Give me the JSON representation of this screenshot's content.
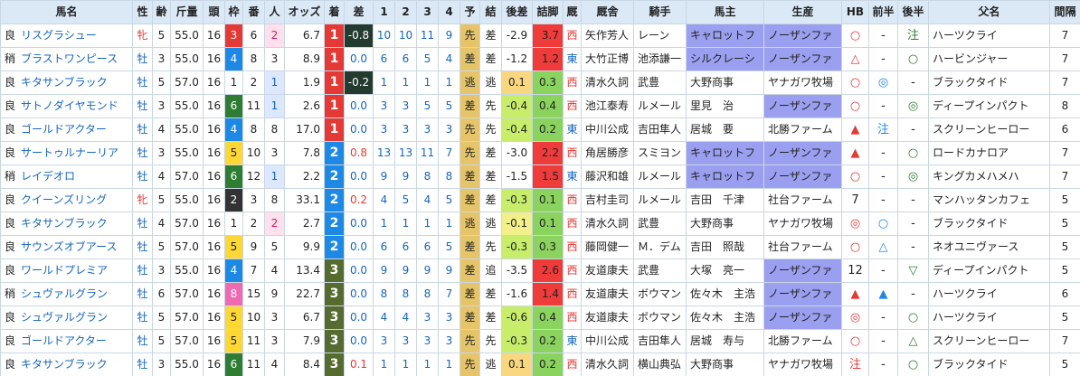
{
  "headers": [
    "馬名",
    "性",
    "齢",
    "斤量",
    "頭",
    "枠",
    "番",
    "人",
    "オッズ",
    "着",
    "差",
    "1",
    "2",
    "3",
    "4",
    "予",
    "結",
    "後差",
    "詰脚",
    "厩",
    "厩舎",
    "騎手",
    "馬主",
    "生産",
    "HB",
    "前半",
    "後半",
    "父名",
    "間隔"
  ],
  "rows": [
    {
      "baba": "良",
      "name": "リスグラシュー",
      "sex": "牝",
      "age": "5",
      "weight": "55.0",
      "heads": "16",
      "waku": "3",
      "ban": "6",
      "ninki": "2",
      "odds": "6.7",
      "chaku": "1",
      "sa": "-0.8",
      "c1": "10",
      "c2": "10",
      "c3": "11",
      "c4": "9",
      "yo": "先",
      "ketsu": "差",
      "atosa": "-2.9",
      "tsume": "3.7",
      "kyu": "西",
      "trainer": "矢作芳人",
      "jockey": "レーン",
      "owner": "キャロットフ",
      "breeder": "ノーザンファ",
      "hb": "○",
      "zen": "-",
      "kou": "注",
      "sire": "ハーツクライ",
      "interval": "7"
    },
    {
      "baba": "稍",
      "name": "ブラストワンピース",
      "sex": "牡",
      "age": "3",
      "weight": "55.0",
      "heads": "16",
      "waku": "4",
      "ban": "8",
      "ninki": "3",
      "odds": "8.9",
      "chaku": "1",
      "sa": "0.0",
      "c1": "6",
      "c2": "6",
      "c3": "5",
      "c4": "4",
      "yo": "差",
      "ketsu": "差",
      "atosa": "-1.2",
      "tsume": "1.2",
      "kyu": "東",
      "trainer": "大竹正博",
      "jockey": "池添謙一",
      "owner": "シルクレーシ",
      "breeder": "ノーザンファ",
      "hb": "△",
      "zen": "-",
      "kou": "○",
      "sire": "ハービンジャー",
      "interval": "7"
    },
    {
      "baba": "良",
      "name": "キタサンブラック",
      "sex": "牡",
      "age": "5",
      "weight": "57.0",
      "heads": "16",
      "waku": "1",
      "ban": "2",
      "ninki": "1",
      "odds": "1.9",
      "chaku": "1",
      "sa": "-0.2",
      "c1": "1",
      "c2": "1",
      "c3": "1",
      "c4": "1",
      "yo": "逃",
      "ketsu": "逃",
      "atosa": "0.1",
      "tsume": "0.3",
      "kyu": "西",
      "trainer": "清水久詞",
      "jockey": "武豊",
      "owner": "大野商事",
      "breeder": "ヤナガワ牧場",
      "hb": "○",
      "zen": "◎",
      "kou": "-",
      "sire": "ブラックタイド",
      "interval": "7"
    },
    {
      "baba": "良",
      "name": "サトノダイヤモンド",
      "sex": "牡",
      "age": "3",
      "weight": "55.0",
      "heads": "16",
      "waku": "6",
      "ban": "11",
      "ninki": "1",
      "odds": "2.6",
      "chaku": "1",
      "sa": "0.0",
      "c1": "3",
      "c2": "3",
      "c3": "5",
      "c4": "5",
      "yo": "差",
      "ketsu": "先",
      "atosa": "-0.4",
      "tsume": "0.4",
      "kyu": "西",
      "trainer": "池江泰寿",
      "jockey": "ルメール",
      "owner": "里見　治",
      "breeder": "ノーザンファ",
      "hb": "○",
      "zen": "-",
      "kou": "◎",
      "sire": "ディープインパクト",
      "interval": "8"
    },
    {
      "baba": "良",
      "name": "ゴールドアクター",
      "sex": "牡",
      "age": "4",
      "weight": "55.0",
      "heads": "16",
      "waku": "4",
      "ban": "8",
      "ninki": "8",
      "odds": "17.0",
      "chaku": "1",
      "sa": "0.0",
      "c1": "3",
      "c2": "3",
      "c3": "3",
      "c4": "3",
      "yo": "先",
      "ketsu": "先",
      "atosa": "-0.4",
      "tsume": "0.2",
      "kyu": "東",
      "trainer": "中川公成",
      "jockey": "吉田隼人",
      "owner": "居城　要",
      "breeder": "北勝ファーム",
      "hb": "▲",
      "zen": "注",
      "kou": "-",
      "sire": "スクリーンヒーロー",
      "interval": "6"
    },
    {
      "baba": "良",
      "name": "サートゥルナーリア",
      "sex": "牡",
      "age": "3",
      "weight": "55.0",
      "heads": "16",
      "waku": "5",
      "ban": "10",
      "ninki": "3",
      "odds": "7.8",
      "chaku": "2",
      "sa": "0.8",
      "c1": "13",
      "c2": "13",
      "c3": "11",
      "c4": "7",
      "yo": "先",
      "ketsu": "差",
      "atosa": "-3.0",
      "tsume": "2.2",
      "kyu": "西",
      "trainer": "角居勝彦",
      "jockey": "スミヨン",
      "owner": "キャロットフ",
      "breeder": "ノーザンファ",
      "hb": "▲",
      "zen": "-",
      "kou": "○",
      "sire": "ロードカナロア",
      "interval": "7"
    },
    {
      "baba": "稍",
      "name": "レイデオロ",
      "sex": "牡",
      "age": "4",
      "weight": "57.0",
      "heads": "16",
      "waku": "6",
      "ban": "12",
      "ninki": "1",
      "odds": "2.2",
      "chaku": "2",
      "sa": "0.0",
      "c1": "9",
      "c2": "9",
      "c3": "8",
      "c4": "8",
      "yo": "差",
      "ketsu": "差",
      "atosa": "-1.5",
      "tsume": "1.5",
      "kyu": "東",
      "trainer": "藤沢和雄",
      "jockey": "ルメール",
      "owner": "キャロットフ",
      "breeder": "ノーザンファ",
      "hb": "○",
      "zen": "-",
      "kou": "◎",
      "sire": "キングカメハメハ",
      "interval": "7"
    },
    {
      "baba": "良",
      "name": "クイーンズリング",
      "sex": "牝",
      "age": "5",
      "weight": "55.0",
      "heads": "16",
      "waku": "2",
      "ban": "3",
      "ninki": "8",
      "odds": "33.1",
      "chaku": "2",
      "sa": "0.2",
      "c1": "4",
      "c2": "5",
      "c3": "4",
      "c4": "5",
      "yo": "差",
      "ketsu": "差",
      "atosa": "-0.3",
      "tsume": "0.1",
      "kyu": "西",
      "trainer": "吉村圭司",
      "jockey": "ルメール",
      "owner": "吉田　千津",
      "breeder": "社台ファーム",
      "hb": "7",
      "zen": "-",
      "kou": "-",
      "sire": "マンハッタンカフェ",
      "interval": "5"
    },
    {
      "baba": "良",
      "name": "キタサンブラック",
      "sex": "牡",
      "age": "4",
      "weight": "57.0",
      "heads": "16",
      "waku": "1",
      "ban": "2",
      "ninki": "2",
      "odds": "2.7",
      "chaku": "2",
      "sa": "0.0",
      "c1": "1",
      "c2": "1",
      "c3": "1",
      "c4": "1",
      "yo": "逃",
      "ketsu": "逃",
      "atosa": "-0.1",
      "tsume": "0.1",
      "kyu": "西",
      "trainer": "清水久詞",
      "jockey": "武豊",
      "owner": "大野商事",
      "breeder": "ヤナガワ牧場",
      "hb": "◎",
      "zen": "○",
      "kou": "-",
      "sire": "ブラックタイド",
      "interval": "5"
    },
    {
      "baba": "良",
      "name": "サウンズオブアース",
      "sex": "牡",
      "age": "5",
      "weight": "57.0",
      "heads": "16",
      "waku": "5",
      "ban": "9",
      "ninki": "5",
      "odds": "9.9",
      "chaku": "2",
      "sa": "0.0",
      "c1": "6",
      "c2": "6",
      "c3": "6",
      "c4": "5",
      "yo": "差",
      "ketsu": "先",
      "atosa": "-0.3",
      "tsume": "0.3",
      "kyu": "西",
      "trainer": "藤岡健一",
      "jockey": "Ｍ．デム",
      "owner": "吉田　照哉",
      "breeder": "社台ファーム",
      "hb": "○",
      "zen": "△",
      "kou": "-",
      "sire": "ネオユニヴァース",
      "interval": "5"
    },
    {
      "baba": "良",
      "name": "ワールドプレミア",
      "sex": "牡",
      "age": "3",
      "weight": "55.0",
      "heads": "16",
      "waku": "4",
      "ban": "7",
      "ninki": "4",
      "odds": "13.4",
      "chaku": "3",
      "sa": "0.0",
      "c1": "9",
      "c2": "9",
      "c3": "9",
      "c4": "9",
      "yo": "差",
      "ketsu": "追",
      "atosa": "-3.5",
      "tsume": "2.6",
      "kyu": "西",
      "trainer": "友道康夫",
      "jockey": "武豊",
      "owner": "大塚　亮一",
      "breeder": "ノーザンファ",
      "hb": "12",
      "zen": "-",
      "kou": "▽",
      "sire": "ディープインパクト",
      "interval": "5"
    },
    {
      "baba": "稍",
      "name": "シュヴァルグラン",
      "sex": "牡",
      "age": "6",
      "weight": "57.0",
      "heads": "16",
      "waku": "8",
      "ban": "15",
      "ninki": "9",
      "odds": "22.7",
      "chaku": "3",
      "sa": "0.0",
      "c1": "8",
      "c2": "8",
      "c3": "8",
      "c4": "7",
      "yo": "差",
      "ketsu": "差",
      "atosa": "-1.6",
      "tsume": "1.4",
      "kyu": "西",
      "trainer": "友道康夫",
      "jockey": "ボウマン",
      "owner": "佐々木　主浩",
      "breeder": "ノーザンファ",
      "hb": "▲",
      "zen": "▲",
      "kou": "-",
      "sire": "ハーツクライ",
      "interval": "6"
    },
    {
      "baba": "良",
      "name": "シュヴァルグラン",
      "sex": "牡",
      "age": "5",
      "weight": "57.0",
      "heads": "16",
      "waku": "5",
      "ban": "10",
      "ninki": "3",
      "odds": "6.7",
      "chaku": "3",
      "sa": "0.0",
      "c1": "4",
      "c2": "4",
      "c3": "3",
      "c4": "3",
      "yo": "差",
      "ketsu": "差",
      "atosa": "-0.6",
      "tsume": "0.4",
      "kyu": "西",
      "trainer": "友道康夫",
      "jockey": "ボウマン",
      "owner": "佐々木　主浩",
      "breeder": "ノーザンファ",
      "hb": "◎",
      "zen": "-",
      "kou": "○",
      "sire": "ハーツクライ",
      "interval": "5"
    },
    {
      "baba": "良",
      "name": "ゴールドアクター",
      "sex": "牡",
      "age": "5",
      "weight": "57.0",
      "heads": "16",
      "waku": "5",
      "ban": "11",
      "ninki": "3",
      "odds": "7.9",
      "chaku": "3",
      "sa": "0.0",
      "c1": "3",
      "c2": "3",
      "c3": "3",
      "c4": "3",
      "yo": "先",
      "ketsu": "先",
      "atosa": "-0.3",
      "tsume": "0.2",
      "kyu": "東",
      "trainer": "中川公成",
      "jockey": "吉田隼人",
      "owner": "居城　寿与",
      "breeder": "北勝ファーム",
      "hb": "○",
      "zen": "-",
      "kou": "△",
      "sire": "スクリーンヒーロー",
      "interval": "7"
    },
    {
      "baba": "良",
      "name": "キタサンブラック",
      "sex": "牡",
      "age": "3",
      "weight": "55.0",
      "heads": "16",
      "waku": "6",
      "ban": "11",
      "ninki": "4",
      "odds": "8.4",
      "chaku": "3",
      "sa": "0.1",
      "c1": "1",
      "c2": "1",
      "c3": "1",
      "c4": "1",
      "yo": "先",
      "ketsu": "逃",
      "atosa": "0.1",
      "tsume": "0.2",
      "kyu": "西",
      "trainer": "清水久詞",
      "jockey": "横山典弘",
      "owner": "大野商事",
      "breeder": "ヤナガワ牧場",
      "hb": "注",
      "zen": "-",
      "kou": "○",
      "sire": "ブラックタイド",
      "interval": "5"
    }
  ]
}
